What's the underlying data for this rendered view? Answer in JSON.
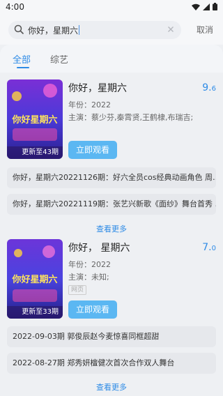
{
  "status": {
    "time": "4:00"
  },
  "search": {
    "query": "你好，星期六",
    "cancel_label": "取消"
  },
  "tabs": [
    {
      "label": "全部",
      "active": true
    },
    {
      "label": "综艺",
      "active": false
    }
  ],
  "results": [
    {
      "title": "你好，星期六",
      "score_int": "9.",
      "score_dec": "6",
      "year": "年份：2022",
      "cast": "主演：蔡少芬,秦霄贤,王鹤棣,布瑞吉;",
      "update_badge": "更新至43期",
      "poster_text": "你好星期六",
      "watch_label": "立即观看",
      "episodes": [
        "你好，星期六20221126期：好六全员cos经典动画角色 周…",
        "你好，星期六20221119期：张艺兴新歌《面纱》舞台首秀 …"
      ],
      "more_label": "查看更多"
    },
    {
      "title": "你好， 星期六",
      "score_int": "7.",
      "score_dec": "0",
      "year": "年份：2022",
      "cast": "主演：未知;",
      "tag": "网页",
      "update_badge": "更新至33期",
      "poster_text": "你好星期六",
      "watch_label": "立即观看",
      "episodes": [
        "2022-09-03期 郭俊辰赵今麦惊喜同框超甜",
        "2022-08-27期 郑秀妍檀健次首次合作双人舞台"
      ],
      "more_label": "查看更多"
    }
  ]
}
